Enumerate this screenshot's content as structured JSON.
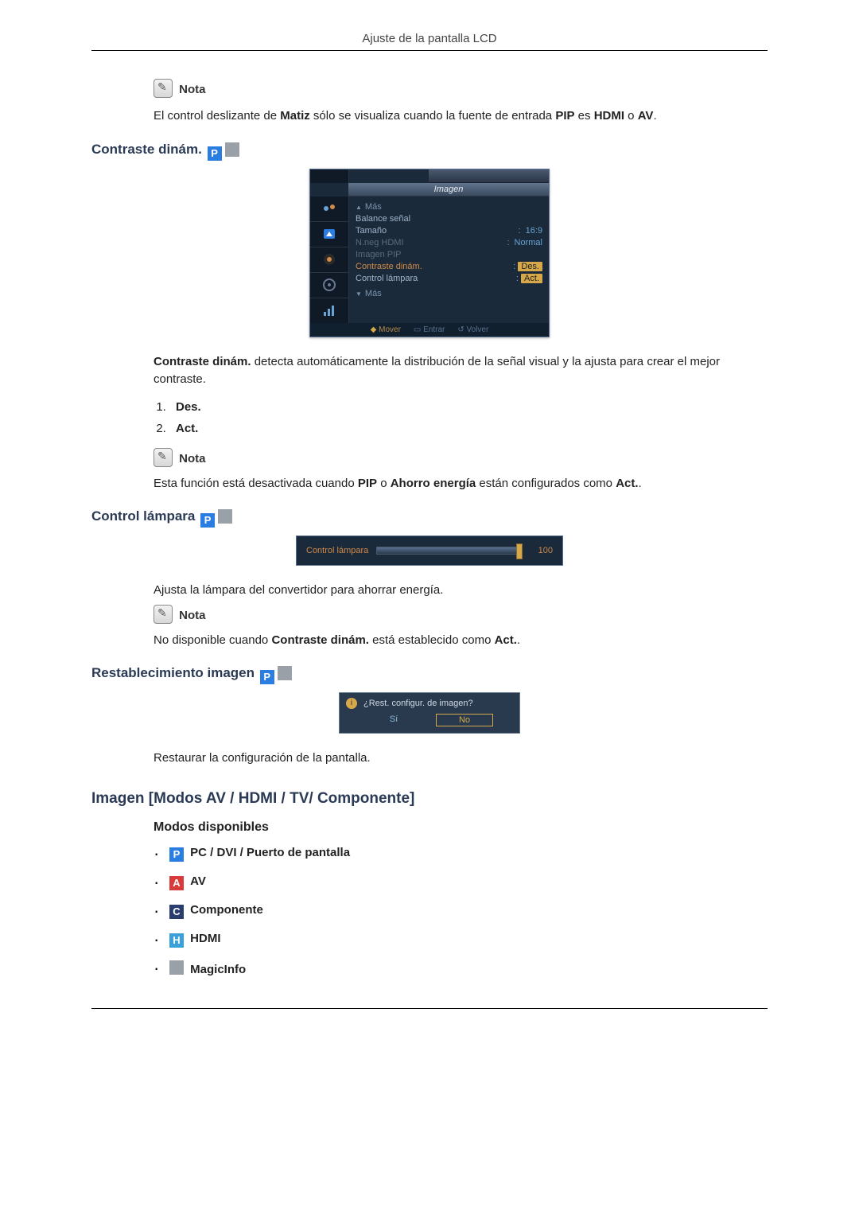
{
  "header": {
    "title": "Ajuste de la pantalla LCD"
  },
  "intro_note": {
    "label": "Nota",
    "text_pre": "El control deslizante de ",
    "text_b1": "Matiz",
    "text_mid": " sólo se visualiza cuando la fuente de entrada ",
    "text_b2": "PIP",
    "text_mid2": " es ",
    "text_b3": "HDMI",
    "text_mid3": " o ",
    "text_b4": "AV",
    "text_end": "."
  },
  "section_contraste": {
    "title": "Contraste dinám.",
    "osd": {
      "title": "Imagen",
      "mas_up": "Más",
      "rows": [
        {
          "label": "Balance señal",
          "value": "",
          "dim": false,
          "hl": false
        },
        {
          "label": "Tamaño",
          "value": "16:9",
          "dim": false,
          "hl": false,
          "prefix": ":"
        },
        {
          "label": "N.neg HDMI",
          "value": "Normal",
          "dim": true,
          "hl": false,
          "prefix": ":"
        },
        {
          "label": "Imagen PIP",
          "value": "",
          "dim": true,
          "hl": false
        },
        {
          "label": "Contraste dinám.",
          "value": "Des.",
          "dim": false,
          "hl": true,
          "prefix": ":"
        },
        {
          "label": "Control lámpara",
          "value": "Act.",
          "dim": false,
          "hl": true,
          "prefix": ":"
        }
      ],
      "mas_down": "Más",
      "footer": {
        "move": "Mover",
        "enter": "Entrar",
        "back": "Volver"
      }
    },
    "desc_b": "Contraste dinám.",
    "desc_rest": " detecta automáticamente la distribución de la señal visual y la ajusta para crear el mejor contraste.",
    "opts": [
      "Des.",
      "Act."
    ],
    "note": {
      "label": "Nota",
      "text_pre": "Esta función está desactivada cuando ",
      "b1": "PIP",
      "mid": " o ",
      "b2": "Ahorro energía",
      "mid2": " están configurados como ",
      "b3": "Act.",
      "end": "."
    }
  },
  "section_lampara": {
    "title": "Control lámpara",
    "slider": {
      "label": "Control lámpara",
      "value": "100"
    },
    "desc": "Ajusta la lámpara del convertidor para ahorrar energía.",
    "note": {
      "label": "Nota",
      "text_pre": "No disponible cuando ",
      "b1": "Contraste dinám.",
      "mid": " está establecido como ",
      "b2": "Act.",
      "end": "."
    }
  },
  "section_reset": {
    "title": "Restablecimiento imagen",
    "dialog": {
      "question": "¿Rest. configur. de imagen?",
      "yes": "Sí",
      "no": "No"
    },
    "desc": "Restaurar la configuración de la pantalla."
  },
  "section_imagen_modes": {
    "title": "Imagen [Modos AV / HDMI / TV/ Componente]",
    "sub": "Modos disponibles",
    "modes": {
      "p": {
        "badge": "P",
        "label": "PC / DVI / Puerto de pantalla"
      },
      "a": {
        "badge": "A",
        "label": "AV"
      },
      "c": {
        "badge": "C",
        "label": "Componente"
      },
      "h": {
        "badge": "H",
        "label": "HDMI"
      },
      "m": {
        "badge": "",
        "label": "MagicInfo"
      }
    }
  }
}
